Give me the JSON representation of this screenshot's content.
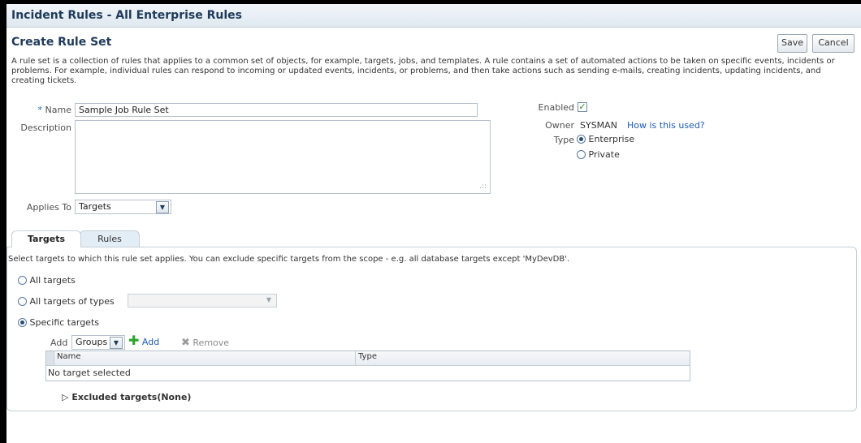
{
  "window": {
    "title": "Incident Rules - All Enterprise Rules"
  },
  "page": {
    "header": "Create Rule Set",
    "save_label": "Save",
    "cancel_label": "Cancel",
    "description": "A rule set is a collection of rules that applies to a common set of objects, for example, targets, jobs, and templates. A rule contains a set of automated actions to be taken on specific events, incidents or problems. For example, individual rules can respond to incoming or updated events, incidents, or problems, and then take actions such as sending e-mails, creating incidents, updating incidents, and creating tickets."
  },
  "form": {
    "name_required_mark": "*",
    "name_label": "Name",
    "name_value": "Sample Job Rule Set",
    "description_label": "Description",
    "description_value": "",
    "applies_to_label": "Applies To",
    "applies_to_value": "Targets",
    "enabled_label": "Enabled",
    "enabled_checked": true,
    "owner_label": "Owner",
    "owner_value": "SYSMAN",
    "how_used_link": "How is this used?",
    "type_label": "Type",
    "type_options": [
      "Enterprise",
      "Private"
    ],
    "type_selected": "Enterprise"
  },
  "tabs": [
    {
      "label": "Targets",
      "active": true
    },
    {
      "label": "Rules",
      "active": false
    }
  ],
  "targets_panel": {
    "instruction": "Select targets to which this rule set applies. You can exclude specific targets from the scope - e.g. all database targets except 'MyDevDB'.",
    "all_targets_label": "All targets",
    "all_types_label": "All targets of types",
    "all_types_value": "",
    "specific_label": "Specific targets",
    "selected_option": "specific",
    "add_label": "Add",
    "add_select_value": "Groups",
    "add_button_label": "Add",
    "remove_button_label": "Remove",
    "columns": [
      "Name",
      "Type"
    ],
    "empty_text": "No target selected",
    "excluded_label": "Excluded targets(None)"
  },
  "colors": {
    "title_text": "#1f3a5a",
    "link": "#1e5bb5",
    "add_icon": "#2fa52f"
  }
}
